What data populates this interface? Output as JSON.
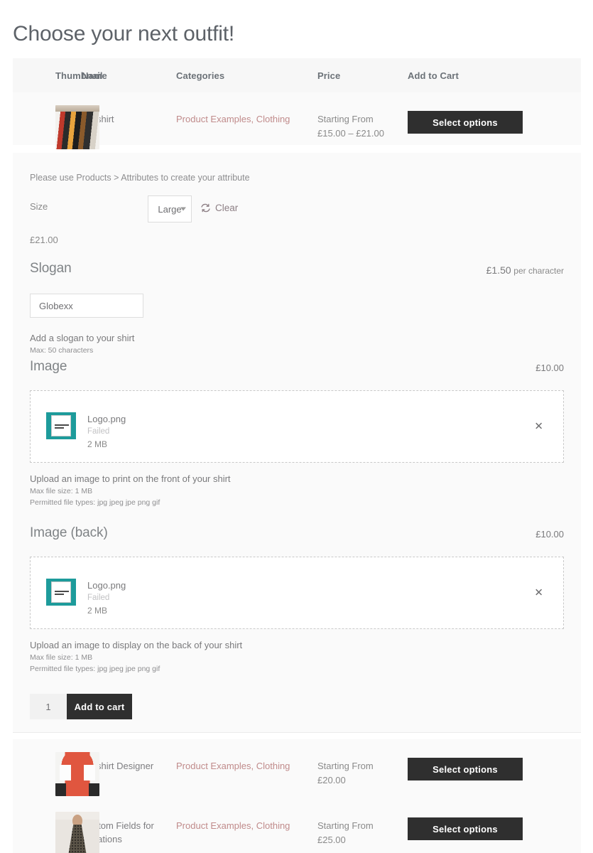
{
  "page": {
    "title": "Choose your next outfit!"
  },
  "table": {
    "headers": {
      "thumbnail": "Thumbnail",
      "name": "Name",
      "categories": "Categories",
      "price": "Price",
      "cart": "Add to Cart"
    },
    "rows": [
      {
        "name": "Teeshirt",
        "categories": "Product Examples, Clothing",
        "price_label": "Starting From",
        "price_value": "£15.00 – £21.00",
        "button": "Select options",
        "thumb": "hanging-teeshirts-thumbnail"
      },
      {
        "name": "Teeshirt Designer",
        "categories": "Product Examples, Clothing",
        "price_label": "Starting From",
        "price_value": "£20.00",
        "button": "Select options",
        "thumb": "teeshirt-models-thumbnail"
      },
      {
        "name": "Custom Fields for Variations",
        "categories": "Product Examples, Clothing",
        "price_label": "Starting From",
        "price_value": "£25.00",
        "button": "Select options",
        "thumb": "patterned-dress-thumbnail"
      }
    ]
  },
  "variation": {
    "attribute_note": "Please use Products > Attributes to create your attribute",
    "size_label": "Size",
    "size_value": "Large",
    "size_options": [
      "Large"
    ],
    "clear_label": "Clear",
    "clear_icon": "refresh-icon",
    "selected_price": "£21.00"
  },
  "slogan": {
    "title": "Slogan",
    "price_amount": "£1.50",
    "price_unit": "per character",
    "input_value": "Globexx",
    "helper": "Add a slogan to your shirt",
    "helper_sub": "Max: 50 characters"
  },
  "image_front": {
    "title": "Image",
    "price": "£10.00",
    "file_name": "Logo.png",
    "file_status": "Failed",
    "file_size": "2 MB",
    "remove_icon": "close-icon",
    "helper": "Upload an image to print on the front of your shirt",
    "helper_size": "Max file size: 1 MB",
    "helper_types": "Permitted file types: jpg jpeg jpe png gif"
  },
  "image_back": {
    "title": "Image (back)",
    "price": "£10.00",
    "file_name": "Logo.png",
    "file_status": "Failed",
    "file_size": "2 MB",
    "remove_icon": "close-icon",
    "helper": "Upload an image to display on the back of your shirt",
    "helper_size": "Max file size: 1 MB",
    "helper_types": "Permitted file types: jpg jpeg jpe png gif"
  },
  "cart": {
    "quantity": "1",
    "add_label": "Add to cart"
  },
  "colors": {
    "button_dark": "#2f2f2f",
    "category_link": "#c08b8b",
    "panel_bg": "#fafafa",
    "header_bg": "#f7f7f7",
    "file_icon": "#1d9b9b"
  }
}
